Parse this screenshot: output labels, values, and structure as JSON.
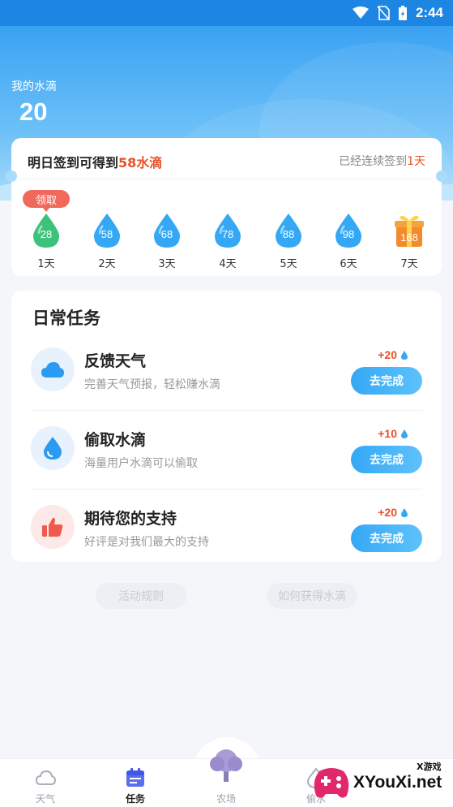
{
  "status_bar": {
    "time": "2:44"
  },
  "header": {
    "my_drops_label": "我的水滴",
    "my_drops_count": "20"
  },
  "signin": {
    "tomorrow_prefix": "明日签到可得到",
    "tomorrow_reward": "58水滴",
    "streak_prefix": "已经连续签到",
    "streak_days": "1天",
    "claim_label": "领取",
    "days": [
      {
        "value": "28",
        "label": "1天",
        "state": "claimable",
        "color": "#3dc27a"
      },
      {
        "value": "58",
        "label": "2天",
        "state": "locked",
        "color": "#34a8f5"
      },
      {
        "value": "68",
        "label": "3天",
        "state": "locked",
        "color": "#34a8f5"
      },
      {
        "value": "78",
        "label": "4天",
        "state": "locked",
        "color": "#34a8f5"
      },
      {
        "value": "88",
        "label": "5天",
        "state": "locked",
        "color": "#34a8f5"
      },
      {
        "value": "98",
        "label": "6天",
        "state": "locked",
        "color": "#34a8f5"
      },
      {
        "value": "168",
        "label": "7天",
        "state": "gift",
        "color": "#f28a2e"
      }
    ]
  },
  "tasks": {
    "title": "日常任务",
    "items": [
      {
        "icon": "cloud-icon",
        "title": "反馈天气",
        "desc": "完善天气预报，轻松赚水滴",
        "reward": "+20",
        "button": "去完成"
      },
      {
        "icon": "water-drop-icon",
        "title": "偷取水滴",
        "desc": "海量用户水滴可以偷取",
        "reward": "+10",
        "button": "去完成"
      },
      {
        "icon": "thumbs-up-icon",
        "title": "期待您的支持",
        "desc": "好评是对我们最大的支持",
        "reward": "+20",
        "button": "去完成"
      }
    ]
  },
  "links": {
    "rules": "活动规则",
    "how_to": "如何获得水滴"
  },
  "bottom_nav": [
    {
      "label": "天气",
      "icon": "cloud-outline-icon",
      "active": false
    },
    {
      "label": "任务",
      "icon": "calendar-icon",
      "active": true
    },
    {
      "label": "农场",
      "icon": "tree-icon",
      "active": false
    },
    {
      "label": "偷水",
      "icon": "drop-outline-icon",
      "active": false
    }
  ],
  "watermark": {
    "text": "XYouXi.net",
    "small": "X游戏"
  },
  "colors": {
    "primary": "#34a8f5",
    "accent": "#e8512a",
    "claim": "#f06a5c"
  }
}
